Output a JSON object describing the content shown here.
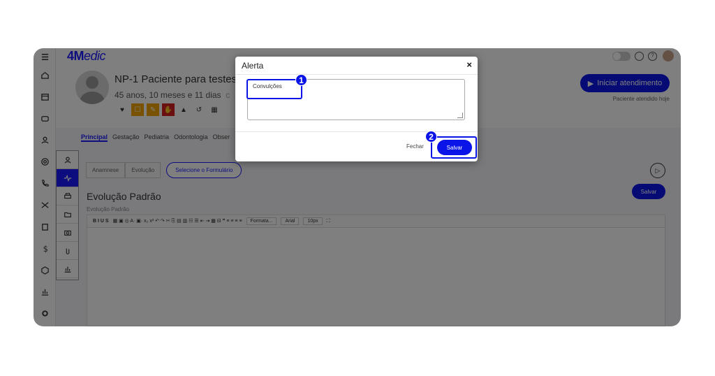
{
  "app": {
    "logo_prefix": "4M",
    "logo_suffix": "edic"
  },
  "patient": {
    "name": "NP-1 Paciente para testes",
    "age": "45 anos, 10 meses e 11 dias",
    "age_suffix": "c",
    "start_button": "Iniciar atendimento",
    "start_sub": "Paciente atendido hoje"
  },
  "tabs": [
    "Principal",
    "Gestação",
    "Pediatria",
    "Odontologia",
    "Obser"
  ],
  "subtabs": {
    "anamnese": "Anamnese",
    "evolucao": "Evolução",
    "form_select": "Selecione o Formulário"
  },
  "editor": {
    "title": "Evolução Padrão",
    "subtitle": "Evolução Padrão",
    "save": "Salvar",
    "toolbar_text": "B  I  U  S",
    "format_dd": "Formata...",
    "font_dd": "Arial",
    "size_dd": "10px"
  },
  "modal": {
    "title": "Alerta",
    "close": "×",
    "textarea_value": "Convulções",
    "cancel": "Fechar",
    "save": "Salvar"
  },
  "annotations": {
    "step1": "1",
    "step2": "2"
  },
  "colors": {
    "accent": "#0a14e8",
    "overlay": "rgba(0,0,0,0.5)"
  }
}
